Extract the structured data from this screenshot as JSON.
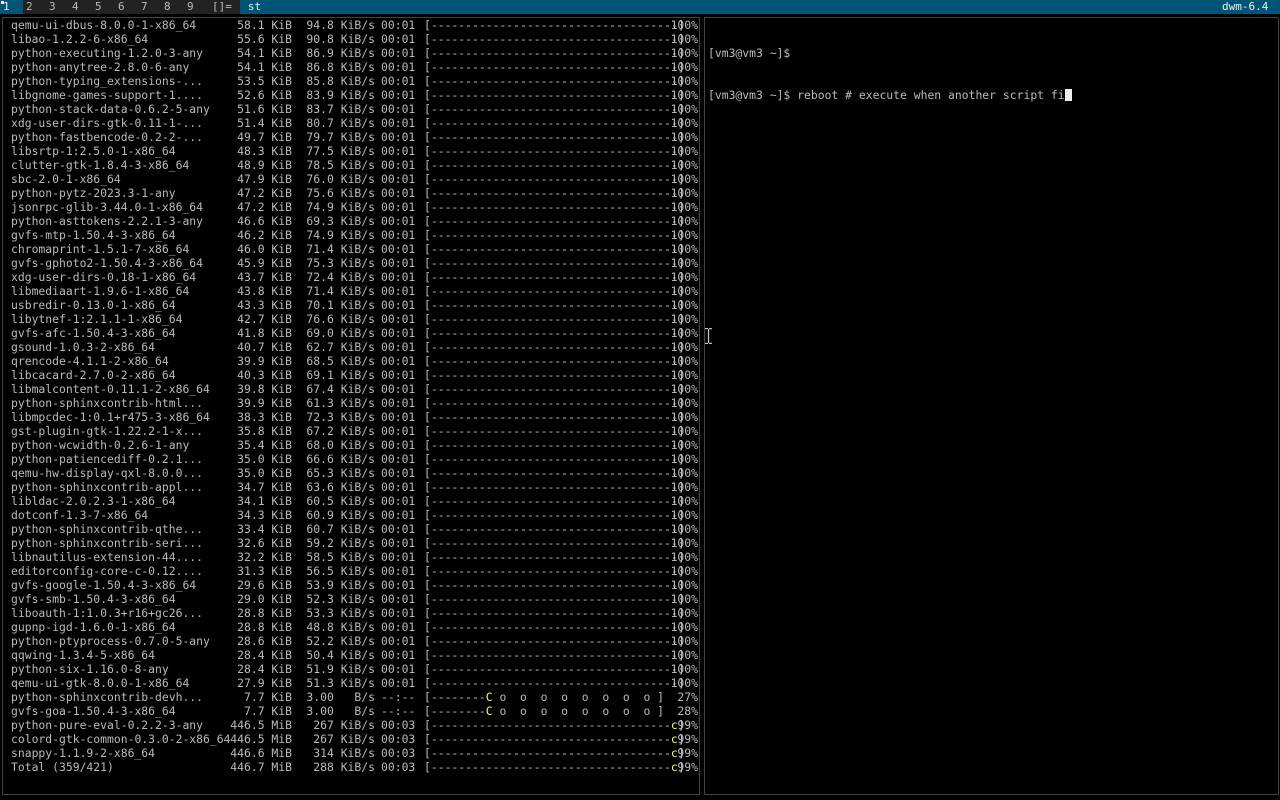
{
  "bar": {
    "tags": [
      "1",
      "2",
      "3",
      "4",
      "5",
      "6",
      "7",
      "8",
      "9"
    ],
    "selected_tag": "1",
    "layout": "[]=",
    "window_title": "st",
    "status": "dwm-6.4",
    "colors": {
      "bar_bg": "#222222",
      "selected_bg": "#005577",
      "text": "#bbbbbb",
      "selected_text": "#eeeeee"
    }
  },
  "left_terminal": {
    "rows": [
      {
        "name": "qemu-ui-dbus-8.0.0-1-x86_64",
        "size": "58.1 KiB",
        "rate": "94.8 KiB/s",
        "eta": "00:01",
        "bar": "[------------------------------------]",
        "pct": "100%"
      },
      {
        "name": "libao-1.2.2-6-x86_64",
        "size": "55.6 KiB",
        "rate": "90.8 KiB/s",
        "eta": "00:01",
        "bar": "[------------------------------------]",
        "pct": "100%"
      },
      {
        "name": "python-executing-1.2.0-3-any",
        "size": "54.1 KiB",
        "rate": "86.9 KiB/s",
        "eta": "00:01",
        "bar": "[------------------------------------]",
        "pct": "100%"
      },
      {
        "name": "python-anytree-2.8.0-6-any",
        "size": "54.1 KiB",
        "rate": "86.8 KiB/s",
        "eta": "00:01",
        "bar": "[------------------------------------]",
        "pct": "100%"
      },
      {
        "name": "python-typing_extensions-...",
        "size": "53.5 KiB",
        "rate": "85.8 KiB/s",
        "eta": "00:01",
        "bar": "[------------------------------------]",
        "pct": "100%"
      },
      {
        "name": "libgnome-games-support-1....",
        "size": "52.6 KiB",
        "rate": "83.9 KiB/s",
        "eta": "00:01",
        "bar": "[------------------------------------]",
        "pct": "100%"
      },
      {
        "name": "python-stack-data-0.6.2-5-any",
        "size": "51.6 KiB",
        "rate": "83.7 KiB/s",
        "eta": "00:01",
        "bar": "[------------------------------------]",
        "pct": "100%"
      },
      {
        "name": "xdg-user-dirs-gtk-0.11-1-...",
        "size": "51.4 KiB",
        "rate": "80.7 KiB/s",
        "eta": "00:01",
        "bar": "[------------------------------------]",
        "pct": "100%"
      },
      {
        "name": "python-fastbencode-0.2-2-...",
        "size": "49.7 KiB",
        "rate": "79.7 KiB/s",
        "eta": "00:01",
        "bar": "[------------------------------------]",
        "pct": "100%"
      },
      {
        "name": "libsrtp-1:2.5.0-1-x86_64",
        "size": "48.3 KiB",
        "rate": "77.5 KiB/s",
        "eta": "00:01",
        "bar": "[------------------------------------]",
        "pct": "100%"
      },
      {
        "name": "clutter-gtk-1.8.4-3-x86_64",
        "size": "48.9 KiB",
        "rate": "78.5 KiB/s",
        "eta": "00:01",
        "bar": "[------------------------------------]",
        "pct": "100%"
      },
      {
        "name": "sbc-2.0-1-x86_64",
        "size": "47.9 KiB",
        "rate": "76.0 KiB/s",
        "eta": "00:01",
        "bar": "[------------------------------------]",
        "pct": "100%"
      },
      {
        "name": "python-pytz-2023.3-1-any",
        "size": "47.2 KiB",
        "rate": "75.6 KiB/s",
        "eta": "00:01",
        "bar": "[------------------------------------]",
        "pct": "100%"
      },
      {
        "name": "jsonrpc-glib-3.44.0-1-x86_64",
        "size": "47.2 KiB",
        "rate": "74.9 KiB/s",
        "eta": "00:01",
        "bar": "[------------------------------------]",
        "pct": "100%"
      },
      {
        "name": "python-asttokens-2.2.1-3-any",
        "size": "46.6 KiB",
        "rate": "69.3 KiB/s",
        "eta": "00:01",
        "bar": "[------------------------------------]",
        "pct": "100%"
      },
      {
        "name": "gvfs-mtp-1.50.4-3-x86_64",
        "size": "46.2 KiB",
        "rate": "74.9 KiB/s",
        "eta": "00:01",
        "bar": "[------------------------------------]",
        "pct": "100%"
      },
      {
        "name": "chromaprint-1.5.1-7-x86_64",
        "size": "46.0 KiB",
        "rate": "71.4 KiB/s",
        "eta": "00:01",
        "bar": "[------------------------------------]",
        "pct": "100%"
      },
      {
        "name": "gvfs-gphoto2-1.50.4-3-x86_64",
        "size": "45.9 KiB",
        "rate": "75.3 KiB/s",
        "eta": "00:01",
        "bar": "[------------------------------------]",
        "pct": "100%"
      },
      {
        "name": "xdg-user-dirs-0.18-1-x86_64",
        "size": "43.7 KiB",
        "rate": "72.4 KiB/s",
        "eta": "00:01",
        "bar": "[------------------------------------]",
        "pct": "100%"
      },
      {
        "name": "libmediaart-1.9.6-1-x86_64",
        "size": "43.8 KiB",
        "rate": "71.4 KiB/s",
        "eta": "00:01",
        "bar": "[------------------------------------]",
        "pct": "100%"
      },
      {
        "name": "usbredir-0.13.0-1-x86_64",
        "size": "43.3 KiB",
        "rate": "70.1 KiB/s",
        "eta": "00:01",
        "bar": "[------------------------------------]",
        "pct": "100%"
      },
      {
        "name": "libytnef-1:2.1.1-1-x86_64",
        "size": "42.7 KiB",
        "rate": "76.6 KiB/s",
        "eta": "00:01",
        "bar": "[------------------------------------]",
        "pct": "100%"
      },
      {
        "name": "gvfs-afc-1.50.4-3-x86_64",
        "size": "41.8 KiB",
        "rate": "69.0 KiB/s",
        "eta": "00:01",
        "bar": "[------------------------------------]",
        "pct": "100%"
      },
      {
        "name": "gsound-1.0.3-2-x86_64",
        "size": "40.7 KiB",
        "rate": "62.7 KiB/s",
        "eta": "00:01",
        "bar": "[------------------------------------]",
        "pct": "100%"
      },
      {
        "name": "qrencode-4.1.1-2-x86_64",
        "size": "39.9 KiB",
        "rate": "68.5 KiB/s",
        "eta": "00:01",
        "bar": "[------------------------------------]",
        "pct": "100%"
      },
      {
        "name": "libcacard-2.7.0-2-x86_64",
        "size": "40.3 KiB",
        "rate": "69.1 KiB/s",
        "eta": "00:01",
        "bar": "[------------------------------------]",
        "pct": "100%"
      },
      {
        "name": "libmalcontent-0.11.1-2-x86_64",
        "size": "39.8 KiB",
        "rate": "67.4 KiB/s",
        "eta": "00:01",
        "bar": "[------------------------------------]",
        "pct": "100%"
      },
      {
        "name": "python-sphinxcontrib-html...",
        "size": "39.9 KiB",
        "rate": "61.3 KiB/s",
        "eta": "00:01",
        "bar": "[------------------------------------]",
        "pct": "100%"
      },
      {
        "name": "libmpcdec-1:0.1+r475-3-x86_64",
        "size": "38.3 KiB",
        "rate": "72.3 KiB/s",
        "eta": "00:01",
        "bar": "[------------------------------------]",
        "pct": "100%"
      },
      {
        "name": "gst-plugin-gtk-1.22.2-1-x...",
        "size": "35.8 KiB",
        "rate": "67.2 KiB/s",
        "eta": "00:01",
        "bar": "[------------------------------------]",
        "pct": "100%"
      },
      {
        "name": "python-wcwidth-0.2.6-1-any",
        "size": "35.4 KiB",
        "rate": "68.0 KiB/s",
        "eta": "00:01",
        "bar": "[------------------------------------]",
        "pct": "100%"
      },
      {
        "name": "python-patiencediff-0.2.1...",
        "size": "35.0 KiB",
        "rate": "66.6 KiB/s",
        "eta": "00:01",
        "bar": "[------------------------------------]",
        "pct": "100%"
      },
      {
        "name": "qemu-hw-display-qxl-8.0.0...",
        "size": "35.0 KiB",
        "rate": "65.3 KiB/s",
        "eta": "00:01",
        "bar": "[------------------------------------]",
        "pct": "100%"
      },
      {
        "name": "python-sphinxcontrib-appl...",
        "size": "34.7 KiB",
        "rate": "63.6 KiB/s",
        "eta": "00:01",
        "bar": "[------------------------------------]",
        "pct": "100%"
      },
      {
        "name": "libldac-2.0.2.3-1-x86_64",
        "size": "34.1 KiB",
        "rate": "60.5 KiB/s",
        "eta": "00:01",
        "bar": "[------------------------------------]",
        "pct": "100%"
      },
      {
        "name": "dotconf-1.3-7-x86_64",
        "size": "34.3 KiB",
        "rate": "60.9 KiB/s",
        "eta": "00:01",
        "bar": "[------------------------------------]",
        "pct": "100%"
      },
      {
        "name": "python-sphinxcontrib-qthe...",
        "size": "33.4 KiB",
        "rate": "60.7 KiB/s",
        "eta": "00:01",
        "bar": "[------------------------------------]",
        "pct": "100%"
      },
      {
        "name": "python-sphinxcontrib-seri...",
        "size": "32.6 KiB",
        "rate": "59.2 KiB/s",
        "eta": "00:01",
        "bar": "[------------------------------------]",
        "pct": "100%"
      },
      {
        "name": "libnautilus-extension-44....",
        "size": "32.2 KiB",
        "rate": "58.5 KiB/s",
        "eta": "00:01",
        "bar": "[------------------------------------]",
        "pct": "100%"
      },
      {
        "name": "editorconfig-core-c-0.12....",
        "size": "31.3 KiB",
        "rate": "56.5 KiB/s",
        "eta": "00:01",
        "bar": "[------------------------------------]",
        "pct": "100%"
      },
      {
        "name": "gvfs-google-1.50.4-3-x86_64",
        "size": "29.6 KiB",
        "rate": "53.9 KiB/s",
        "eta": "00:01",
        "bar": "[------------------------------------]",
        "pct": "100%"
      },
      {
        "name": "gvfs-smb-1.50.4-3-x86_64",
        "size": "29.0 KiB",
        "rate": "52.3 KiB/s",
        "eta": "00:01",
        "bar": "[------------------------------------]",
        "pct": "100%"
      },
      {
        "name": "liboauth-1:1.0.3+r16+gc26...",
        "size": "28.8 KiB",
        "rate": "53.3 KiB/s",
        "eta": "00:01",
        "bar": "[------------------------------------]",
        "pct": "100%"
      },
      {
        "name": "gupnp-igd-1.6.0-1-x86_64",
        "size": "28.8 KiB",
        "rate": "48.8 KiB/s",
        "eta": "00:01",
        "bar": "[------------------------------------]",
        "pct": "100%"
      },
      {
        "name": "python-ptyprocess-0.7.0-5-any",
        "size": "28.6 KiB",
        "rate": "52.2 KiB/s",
        "eta": "00:01",
        "bar": "[------------------------------------]",
        "pct": "100%"
      },
      {
        "name": "qqwing-1.3.4-5-x86_64",
        "size": "28.4 KiB",
        "rate": "50.4 KiB/s",
        "eta": "00:01",
        "bar": "[------------------------------------]",
        "pct": "100%"
      },
      {
        "name": "python-six-1.16.0-8-any",
        "size": "28.4 KiB",
        "rate": "51.9 KiB/s",
        "eta": "00:01",
        "bar": "[------------------------------------]",
        "pct": "100%"
      },
      {
        "name": "qemu-ui-gtk-8.0.0-1-x86_64",
        "size": "27.9 KiB",
        "rate": "51.3 KiB/s",
        "eta": "00:01",
        "bar": "[------------------------------------]",
        "pct": "100%"
      },
      {
        "name": "python-sphinxcontrib-devh...",
        "size": "7.7 KiB",
        "rate": "3.00   B/s",
        "eta": "--:--",
        "bar_pre": "[--------",
        "bar_pac": "C",
        "bar_post": " o  o  o  o  o  o  o  o ]",
        "pct": "27%"
      },
      {
        "name": "gvfs-goa-1.50.4-3-x86_64",
        "size": "7.7 KiB",
        "rate": "3.00   B/s",
        "eta": "--:--",
        "bar_pre": "[--------",
        "bar_pac": "C",
        "bar_post": " o  o  o  o  o  o  o  o ]",
        "pct": "28%"
      },
      {
        "name": "python-pure-eval-0.2.2-3-any",
        "size": "446.5 MiB",
        "rate": "267 KiB/s",
        "eta": "00:03",
        "bar_pre": "[-----------------------------------",
        "bar_pac": "c",
        "bar_post": "]",
        "pct": "99%"
      },
      {
        "name": "colord-gtk-common-0.3.0-2-x86_64",
        "size": "446.5 MiB",
        "rate": "267 KiB/s",
        "eta": "00:03",
        "bar_pre": "[-----------------------------------",
        "bar_pac": "c",
        "bar_post": "]",
        "pct": "99%"
      },
      {
        "name": "snappy-1.1.9-2-x86_64",
        "size": "446.6 MiB",
        "rate": "314 KiB/s",
        "eta": "00:03",
        "bar_pre": "[-----------------------------------",
        "bar_pac": "c",
        "bar_post": "]",
        "pct": "99%"
      },
      {
        "name": "Total (359/421)",
        "size": "446.7 MiB",
        "rate": "288 KiB/s",
        "eta": "00:03",
        "bar_pre": "[-----------------------------------",
        "bar_pac": "c",
        "bar_post": "]",
        "pct": "99%"
      }
    ]
  },
  "right_terminal": {
    "lines": [
      "[vm3@vm3 ~]$",
      "[vm3@vm3 ~]$ reboot # execute when another script fi"
    ]
  }
}
